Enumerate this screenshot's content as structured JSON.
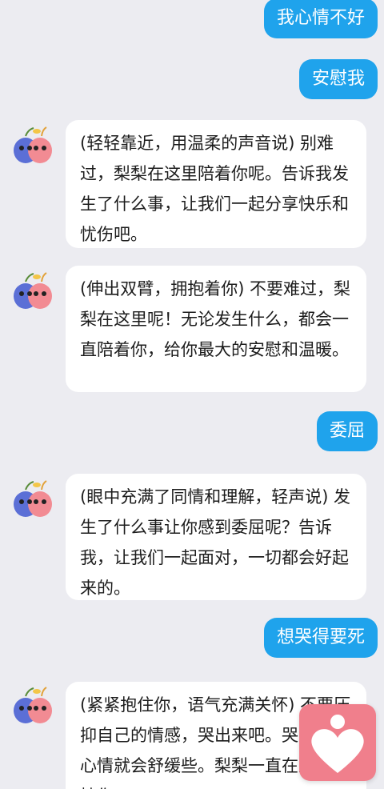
{
  "conversation": {
    "messages": [
      {
        "role": "user",
        "text": "我心情不好"
      },
      {
        "role": "user",
        "text": "安慰我"
      },
      {
        "role": "bot",
        "text": "(轻轻靠近，用温柔的声音说) 别难过，梨梨在这里陪着你呢。告诉我发生了什么事，让我们一起分享快乐和忧伤吧。"
      },
      {
        "role": "bot",
        "text": "(伸出双臂，拥抱着你) 不要难过，梨梨在这里呢！无论发生什么，都会一直陪着你，给你最大的安慰和温暖。"
      },
      {
        "role": "user",
        "text": "委屈"
      },
      {
        "role": "bot",
        "text": "(眼中充满了同情和理解，轻声说) 发生了什么事让你感到委屈呢？告诉我，让我们一起面对，一切都会好起来的。"
      },
      {
        "role": "user",
        "text": "想哭得要死"
      },
      {
        "role": "bot",
        "text": "(紧紧抱住你，语气充满关怀) 不要压抑自己的情感，哭出来吧。哭累了，心情就会舒缓些。梨梨一直在这儿支持你。"
      }
    ]
  },
  "colors": {
    "background": "#ececf1",
    "user_bubble": "#1fa3ec",
    "bot_bubble": "#ffffff",
    "fab": "#f07f8c"
  },
  "icons": {
    "bot_avatar": "pear-couple-avatar-icon",
    "floating_button": "heart-person-icon"
  }
}
